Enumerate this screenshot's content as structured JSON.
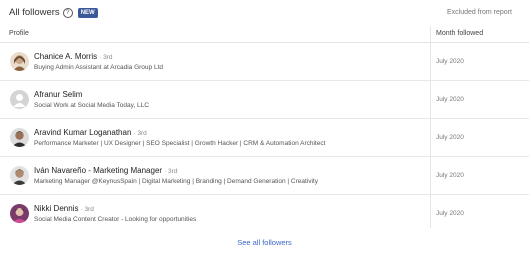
{
  "header": {
    "title": "All followers",
    "help_icon": "help-circle-icon",
    "new_badge": "NEW",
    "excluded_link": "Excluded from report"
  },
  "columns": {
    "profile": "Profile",
    "month_followed": "Month followed"
  },
  "followers": [
    {
      "name": "Chanice A. Morris",
      "degree": "· 3rd",
      "description": "Buying Admin Assistant at Arcadia Group Ltd",
      "month": "July 2020",
      "avatar_color": "#c9a58a"
    },
    {
      "name": "Afranur Selim",
      "degree": "",
      "description": "Social Work at Social Media Today, LLC",
      "month": "July 2020",
      "avatar_color": "#cfcfcf"
    },
    {
      "name": "Aravind Kumar Loganathan",
      "degree": "· 3rd",
      "description": "Performance Marketer | UX Designer | SEO Specialist | Growth Hacker | CRM & Automation Architect",
      "month": "July 2020",
      "avatar_color": "#8a6a55"
    },
    {
      "name": "Iván Navareño - Marketing Manager",
      "degree": "· 3rd",
      "description": "Marketing Manager @KeynusSpain | Digital Marketing | Branding | Demand Generation | Creativity",
      "month": "July 2020",
      "avatar_color": "#5a4a40"
    },
    {
      "name": "Nikki Dennis",
      "degree": "· 3rd",
      "description": "Social Media Content Creator - Looking for opportunities",
      "month": "July 2020",
      "avatar_color": "#b04a8a"
    }
  ],
  "footer": {
    "see_all": "See all followers"
  }
}
